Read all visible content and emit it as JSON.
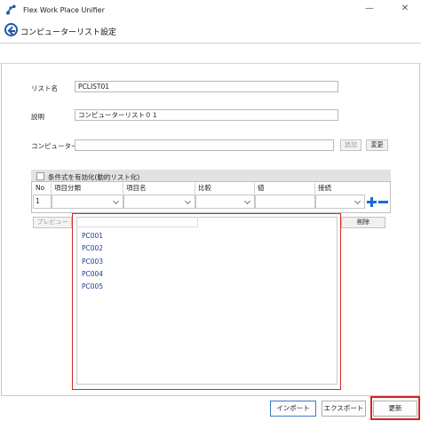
{
  "app": {
    "title": "Flex Work Place Unifier"
  },
  "window": {
    "minimize": "—",
    "close": "✕"
  },
  "header": {
    "title": "コンピューターリスト設定"
  },
  "form": {
    "list_name_label": "リスト名",
    "list_name_value": "PCLIST01",
    "description_label": "説明",
    "description_value": "コンピューターリスト０１",
    "computer_name_label": "コンピューター名",
    "computer_name_value": "",
    "add_label": "追加",
    "change_label": "変更"
  },
  "conditions": {
    "enable_label": "条件式を有効化(動的リスト化)",
    "columns": [
      "No",
      "項目分類",
      "項目名",
      "比較",
      "値",
      "接続"
    ],
    "row_no": "1"
  },
  "preview_label": "プレビュー",
  "delete_label": "削除",
  "computers": [
    "PC001",
    "PC002",
    "PC003",
    "PC004",
    "PC005"
  ],
  "footer": {
    "import_label": "インポート",
    "export_label": "エクスポート",
    "update_label": "更新"
  },
  "colors": {
    "accent": "#1f57a4",
    "highlight": "#d32626",
    "list_text": "#1f3f8f"
  }
}
